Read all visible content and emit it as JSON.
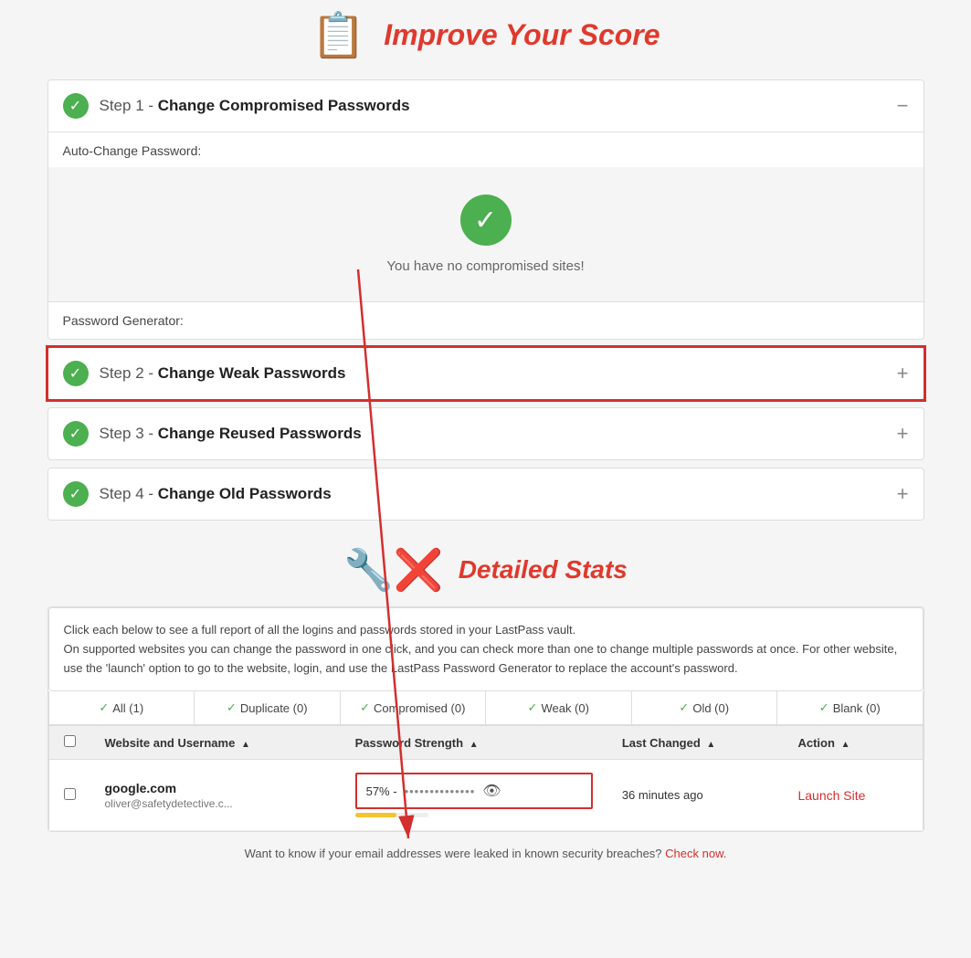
{
  "header": {
    "title": "Improve Your Score",
    "clipboard_emoji": "📋"
  },
  "steps": [
    {
      "number": "1",
      "label": "Step 1 - ",
      "title": "Change Compromised Passwords",
      "toggle": "−",
      "expanded": true
    },
    {
      "number": "2",
      "label": "Step 2 - ",
      "title": "Change Weak Passwords",
      "toggle": "+",
      "expanded": false,
      "highlighted": true
    },
    {
      "number": "3",
      "label": "Step 3 - ",
      "title": "Change Reused Passwords",
      "toggle": "+",
      "expanded": false
    },
    {
      "number": "4",
      "label": "Step 4 - ",
      "title": "Change Old Passwords",
      "toggle": "+",
      "expanded": false
    }
  ],
  "step1": {
    "auto_change_label": "Auto-Change Password:",
    "no_compromised_message": "You have no compromised sites!",
    "password_generator_label": "Password Generator:"
  },
  "detailed_stats": {
    "title": "Detailed Stats",
    "tools_emoji": "🔧"
  },
  "info_box": {
    "text": "Click each below to see a full report of all the logins and passwords stored in your LastPass vault.\nOn supported websites you can change the password in one click, and you can check more than one to change multiple passwords at once. For other website, use the 'launch' option to go to the website, login, and use the LastPass Password Generator to replace the account's password."
  },
  "filter_tabs": [
    {
      "label": "All (1)",
      "check": "✓"
    },
    {
      "label": "Duplicate (0)",
      "check": "✓"
    },
    {
      "label": "Compromised (0)",
      "check": "✓"
    },
    {
      "label": "Weak (0)",
      "check": "✓"
    },
    {
      "label": "Old (0)",
      "check": "✓"
    },
    {
      "label": "Blank (0)",
      "check": "✓"
    }
  ],
  "table": {
    "headers": [
      {
        "label": "Website and Username",
        "sort": "▲"
      },
      {
        "label": "Password Strength",
        "sort": "▲"
      },
      {
        "label": "Last Changed",
        "sort": "▲"
      },
      {
        "label": "Action",
        "sort": "▲"
      }
    ],
    "rows": [
      {
        "site": "google.com",
        "username": "oliver@safetydetective.c...",
        "strength_percent": "57% -",
        "strength_dots": "••••••••••••••",
        "strength_bar_pct": 57,
        "last_changed": "36 minutes ago",
        "action": "Launch Site"
      }
    ]
  },
  "footer": {
    "text": "Want to know if your email addresses were leaked in known security breaches?",
    "link_text": "Check now."
  }
}
